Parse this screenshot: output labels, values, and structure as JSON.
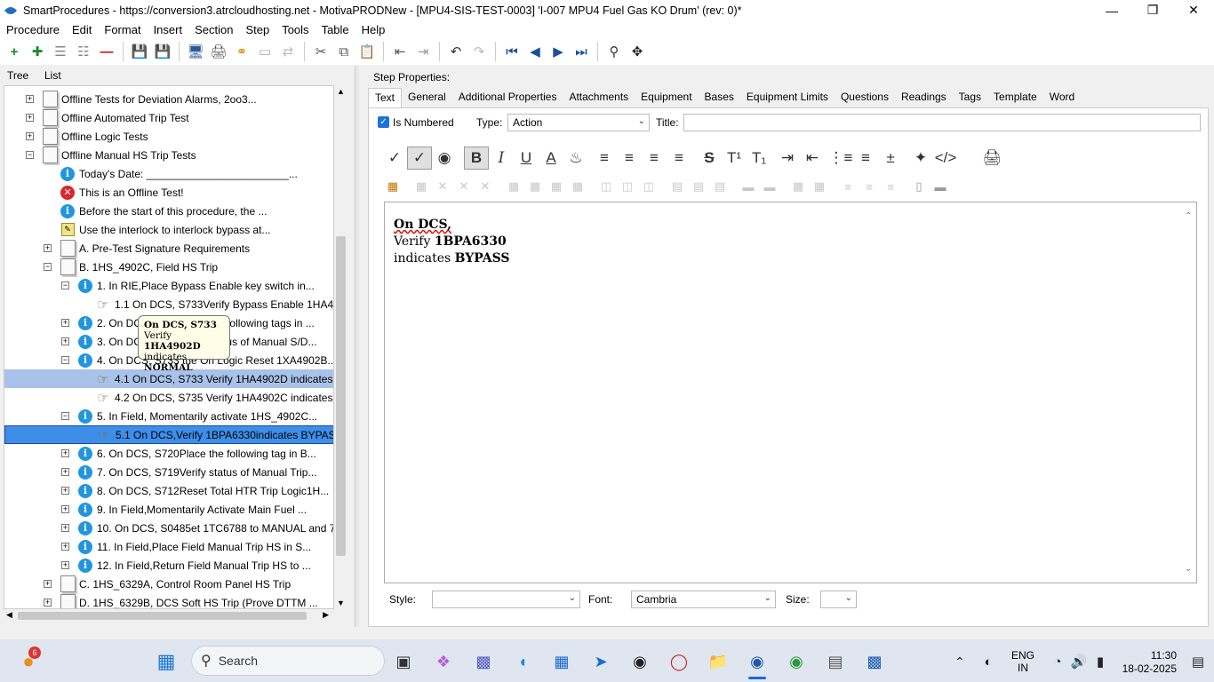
{
  "window": {
    "title": "SmartProcedures - https://conversion3.atrcloudhosting.net - MotivaPRODNew - [MPU4-SIS-TEST-0003] 'I-007 MPU4 Fuel Gas KO Drum' (rev: 0)*"
  },
  "menu": [
    "Procedure",
    "Edit",
    "Format",
    "Insert",
    "Section",
    "Step",
    "Tools",
    "Table",
    "Help"
  ],
  "left_tabs": [
    "Tree",
    "List"
  ],
  "tree": [
    {
      "label": "Offline Tests for Deviation Alarms, 2oo3...",
      "icon": "doc",
      "exp": "+",
      "indent": 0
    },
    {
      "label": "Offline Automated Trip Test",
      "icon": "doc",
      "exp": "+",
      "indent": 0
    },
    {
      "label": "Offline Logic Tests",
      "icon": "doc",
      "exp": "+",
      "indent": 0
    },
    {
      "label": "Offline Manual HS Trip Tests",
      "icon": "doc",
      "exp": "-",
      "indent": 0
    },
    {
      "label": "Today's Date: ________________________...",
      "icon": "info",
      "exp": "",
      "indent": 1
    },
    {
      "label": "This is an Offline Test!",
      "icon": "error",
      "exp": "",
      "indent": 1
    },
    {
      "label": "Before the start of this procedure, the ...",
      "icon": "info",
      "exp": "",
      "indent": 1
    },
    {
      "label": "Use the interlock to interlock bypass at...",
      "icon": "note",
      "exp": "",
      "indent": 1
    },
    {
      "label": "A. Pre-Test Signature Requirements",
      "icon": "doc",
      "exp": "+",
      "indent": 1
    },
    {
      "label": "B. 1HS_4902C, Field HS Trip",
      "icon": "doc",
      "exp": "-",
      "indent": 1
    },
    {
      "label": "1. In RIE,Place Bypass Enable key switch in...",
      "icon": "info",
      "exp": "-",
      "indent": 2
    },
    {
      "label": "1.1 On DCS, S733Verify Bypass Enable 1HA49...",
      "icon": "hand",
      "exp": "",
      "indent": 3
    },
    {
      "label": "2. On DCS, S733Verify the following tags in ...",
      "icon": "info",
      "exp": "+",
      "indent": 2
    },
    {
      "label": "3. On DCS, S735Verify status of Manual S/D...",
      "icon": "info",
      "exp": "+",
      "indent": 2
    },
    {
      "label": "4. On DCS, S733 the On Logic Reset 1XA4902B...",
      "icon": "info",
      "exp": "-",
      "indent": 2
    },
    {
      "label": "4.1 On DCS, S733 Verify 1HA4902D indicates...",
      "icon": "hand",
      "exp": "",
      "indent": 3,
      "sel": 1
    },
    {
      "label": "4.2 On DCS, S735 Verify 1HA4902C indicates...",
      "icon": "hand",
      "exp": "",
      "indent": 3
    },
    {
      "label": "5. In Field, Momentarily activate 1HS_4902C...",
      "icon": "info",
      "exp": "-",
      "indent": 2
    },
    {
      "label": "5.1 On DCS,Verify 1BPA6330indicates BYPASS",
      "icon": "hand",
      "exp": "",
      "indent": 3,
      "sel": 2
    },
    {
      "label": "6. On DCS, S720Place the following tag in B...",
      "icon": "info",
      "exp": "+",
      "indent": 2
    },
    {
      "label": "7. On DCS, S719Verify status of Manual Trip...",
      "icon": "info",
      "exp": "+",
      "indent": 2
    },
    {
      "label": "8. On DCS, S712Reset Total HTR Trip Logic1H...",
      "icon": "info",
      "exp": "+",
      "indent": 2
    },
    {
      "label": "9. In Field,Momentarily Activate Main Fuel ...",
      "icon": "info",
      "exp": "+",
      "indent": 2
    },
    {
      "label": "10. On DCS, S0485et 1TC6788 to MANUAL and 75...",
      "icon": "info",
      "exp": "+",
      "indent": 2
    },
    {
      "label": "11. In Field,Place Field Manual Trip HS in S...",
      "icon": "info",
      "exp": "+",
      "indent": 2
    },
    {
      "label": "12. In Field,Return Field Manual Trip HS to ...",
      "icon": "info",
      "exp": "+",
      "indent": 2
    },
    {
      "label": "C. 1HS_6329A, Control Room Panel HS Trip",
      "icon": "doc",
      "exp": "+",
      "indent": 1
    },
    {
      "label": "D. 1HS_6329B, DCS Soft HS Trip (Prove DTTM ...",
      "icon": "doc",
      "exp": "+",
      "indent": 1
    }
  ],
  "tooltip": {
    "line1": "On DCS, S733",
    "line2_prefix": "Verify ",
    "line2_bold": "1HA4902D",
    "line3_prefix": "indicates ",
    "line3_bold": "NORMAL"
  },
  "step_properties": {
    "heading": "Step Properties:",
    "tabs": [
      "Text",
      "General",
      "Additional Properties",
      "Attachments",
      "Equipment",
      "Bases",
      "Equipment Limits",
      "Questions",
      "Readings",
      "Tags",
      "Template",
      "Word"
    ],
    "is_numbered_label": "Is Numbered",
    "type_label": "Type:",
    "type_value": "Action",
    "title_label": "Title:",
    "title_value": ""
  },
  "editor": {
    "line1": "On DCS,",
    "line2_prefix": "Verify ",
    "line2_bold": "1BPA6330",
    "line3_prefix": "indicates ",
    "line3_bold": "BYPASS"
  },
  "bottom": {
    "style_label": "Style:",
    "style_value": "",
    "font_label": "Font:",
    "font_value": "Cambria",
    "size_label": "Size:",
    "size_value": ""
  },
  "taskbar": {
    "search_label": "Search",
    "notification_count": "6",
    "lang_line1": "ENG",
    "lang_line2": "IN",
    "time": "11:30",
    "date": "18-02-2025"
  }
}
